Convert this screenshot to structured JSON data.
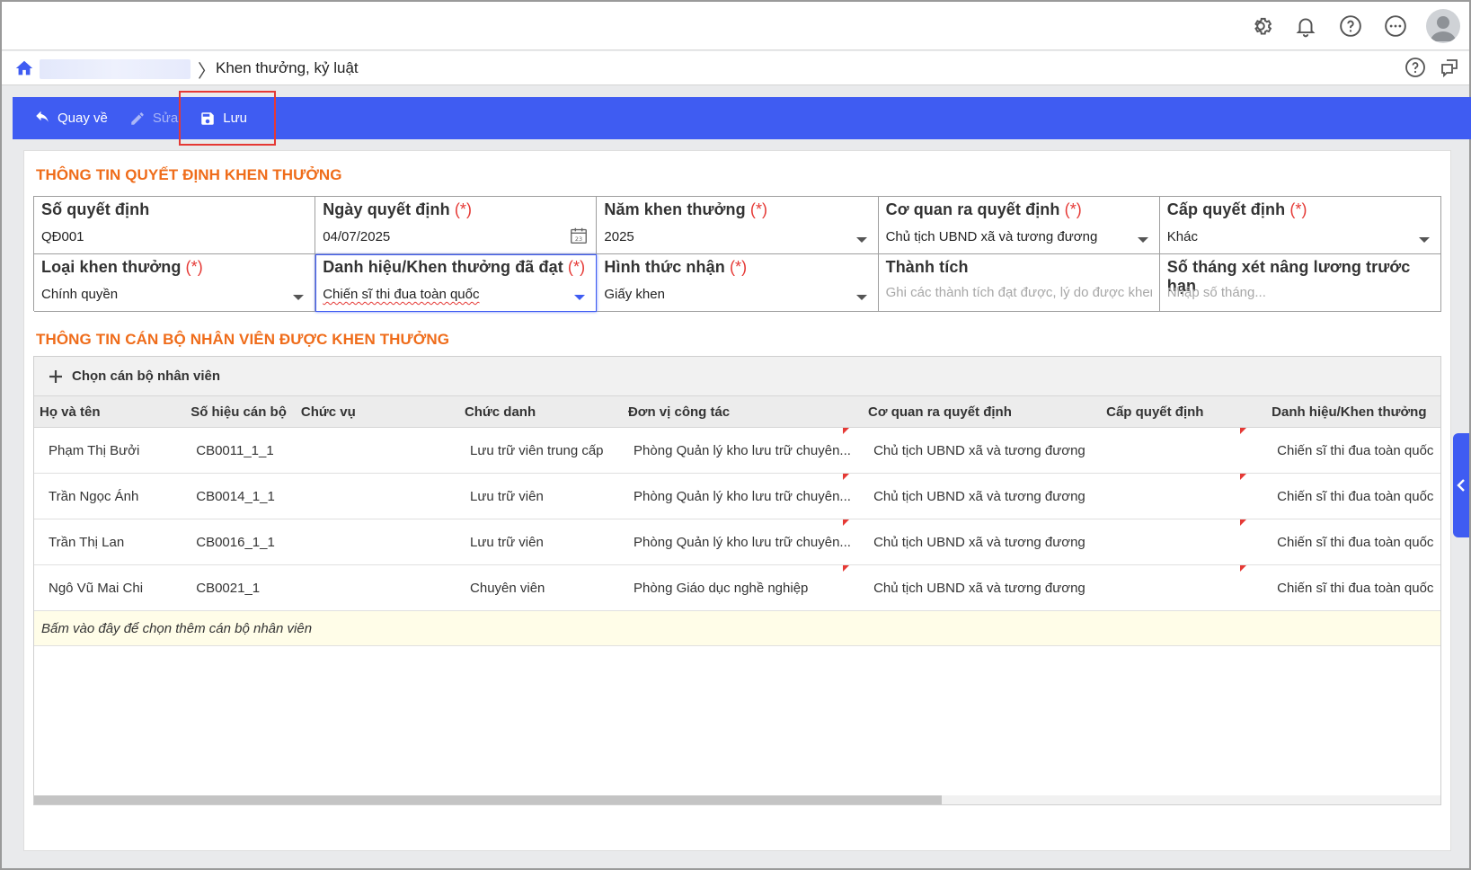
{
  "breadcrumb": {
    "separator": "〉",
    "current": "Khen thưởng, kỷ luật"
  },
  "toolbar": {
    "back_label": "Quay về",
    "edit_label": "Sửa",
    "save_label": "Lưu"
  },
  "decision_section": {
    "title": "THÔNG TIN QUYẾT ĐỊNH KHEN THƯỞNG",
    "required_mark": "(*)",
    "fields": {
      "decision_number": {
        "label": "Số quyết định",
        "value": "QĐ001"
      },
      "decision_date": {
        "label": "Ngày quyết định",
        "value": "04/07/2025"
      },
      "reward_year": {
        "label": "Năm khen thưởng",
        "value": "2025"
      },
      "issuing_agency": {
        "label": "Cơ quan ra quyết định",
        "value": "Chủ tịch UBND xã và tương đương"
      },
      "decision_level": {
        "label": "Cấp quyết định",
        "value": "Khác"
      },
      "reward_type": {
        "label": "Loại khen thưởng",
        "value": "Chính quyền"
      },
      "title_achieved": {
        "label": "Danh hiệu/Khen thưởng đã đạt",
        "value": "Chiến sĩ thi đua toàn quốc"
      },
      "receive_form": {
        "label": "Hình thức nhận",
        "value": "Giấy khen"
      },
      "achievement": {
        "label": "Thành tích",
        "placeholder": "Ghi các thành tích đạt được, lý do được khen thưởng"
      },
      "early_raise_months": {
        "label": "Số tháng xét nâng lương trước hạn",
        "placeholder": "Nhập số tháng..."
      }
    }
  },
  "employee_section": {
    "title": "THÔNG TIN CÁN BỘ NHÂN VIÊN ĐƯỢC KHEN THƯỞNG",
    "add_label": "Chọn cán bộ nhân viên",
    "columns": [
      "Họ và tên",
      "Số hiệu cán bộ",
      "Chức vụ",
      "Chức danh",
      "Đơn vị công tác",
      "Cơ quan ra quyết định",
      "Cấp quyết định",
      "Danh hiệu/Khen thưởng"
    ],
    "rows": [
      {
        "name": "Phạm Thị Bưởi",
        "code": "CB0011_1_1",
        "position": "",
        "title": "Lưu trữ viên trung cấp",
        "unit": "Phòng Quản lý kho lưu trữ chuyên...",
        "agency": "Chủ tịch UBND xã và tương đương",
        "level": "",
        "award": "Chiến sĩ thi đua toàn quốc"
      },
      {
        "name": "Trần Ngọc Ánh",
        "code": "CB0014_1_1",
        "position": "",
        "title": "Lưu trữ viên",
        "unit": "Phòng Quản lý kho lưu trữ chuyên...",
        "agency": "Chủ tịch UBND xã và tương đương",
        "level": "",
        "award": "Chiến sĩ thi đua toàn quốc"
      },
      {
        "name": "Trần Thị Lan",
        "code": "CB0016_1_1",
        "position": "",
        "title": "Lưu trữ viên",
        "unit": "Phòng Quản lý kho lưu trữ chuyên...",
        "agency": "Chủ tịch UBND xã và tương đương",
        "level": "",
        "award": "Chiến sĩ thi đua toàn quốc"
      },
      {
        "name": "Ngô Vũ Mai Chi",
        "code": "CB0021_1",
        "position": "",
        "title": "Chuyên viên",
        "unit": "Phòng Giáo dục nghề nghiệp",
        "agency": "Chủ tịch UBND xã và tương đương",
        "level": "",
        "award": "Chiến sĩ thi đua toàn quốc"
      }
    ],
    "hint": "Bấm vào đây để chọn thêm cán bộ nhân viên"
  },
  "colors": {
    "accent": "#3f5cf2",
    "section_title": "#ef6c1a",
    "required": "#e53935"
  },
  "icons": [
    "gear-icon",
    "bell-icon",
    "help-icon",
    "more-icon",
    "avatar",
    "home-icon",
    "help-icon",
    "feedback-icon",
    "undo-icon",
    "pencil-icon",
    "save-icon",
    "calendar-icon",
    "plus-icon",
    "chevron-left-icon"
  ]
}
